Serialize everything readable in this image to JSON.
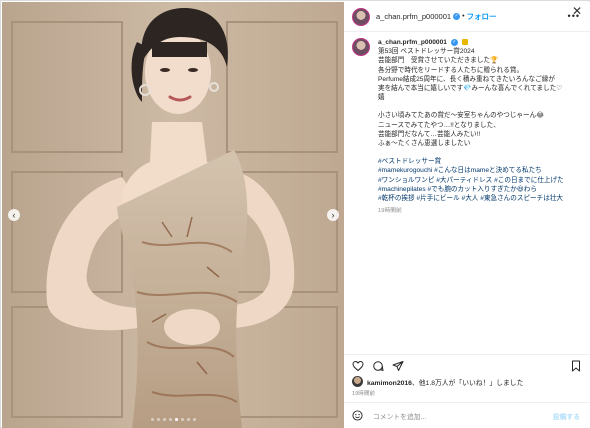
{
  "window": {
    "close_icon": "close-icon"
  },
  "header": {
    "username": "a_chan.prfm_p000001",
    "verified_icon": "verified-badge-icon",
    "separator": "•",
    "follow_label": "フォロー",
    "more_icon": "more-icon"
  },
  "caption": {
    "username": "a_chan.prfm_p000001",
    "lines": [
      "第53回 ベストドレッサー賞2024",
      "芸能部門　受賞させていただきました🏆",
      "各分野で時代をリードする人たちに贈られる賞。",
      "Perfume結成25周年に、長く積み重ねてきたいろんなご縁が",
      "実を結んで本当に嬉しいです💎みーんな喜んでくれてました♡",
      "嬉"
    ],
    "lines2": [
      "小さい頃みてたあの賞だ〜安室ちゃんのやつじゃーん😂",
      "ニュースでみてたやつ…!!となりました、",
      "芸能部門だなんて…芸能人みたい!!",
      "ふぁ〜たくさん恵選しましたい"
    ],
    "hashtag_lines": [
      "#ベストドレッサー賞",
      "#mamekurogouchi #こんな日はmameと決めてる私たち",
      "#ワンショルワンピ #大パーティドレス #この日までに仕上げた",
      "#machinepilates #でも腕のカット入りすぎたか😆わら",
      "#乾杯の挨拶 #片手にビール #大人 #東急さんのスピーチは壮大"
    ],
    "time": "19時間前"
  },
  "actions": {
    "like_icon": "heart-icon",
    "comment_icon": "comment-icon",
    "share_icon": "share-icon",
    "save_icon": "bookmark-icon"
  },
  "likes": {
    "user": "kamimon2016",
    "text": "、他1.8万人が「いいね！」しました"
  },
  "posted_ago": "19時間前",
  "comment": {
    "emoji_icon": "emoji-icon",
    "placeholder": "コメントを追加...",
    "post_label": "投稿する"
  },
  "media": {
    "prev_icon": "chevron-left-icon",
    "next_icon": "chevron-right-icon",
    "slide_count": 8,
    "active_slide": 5
  },
  "colors": {
    "accent": "#0095f6",
    "link": "#00376b",
    "muted": "#8e8e8e"
  }
}
